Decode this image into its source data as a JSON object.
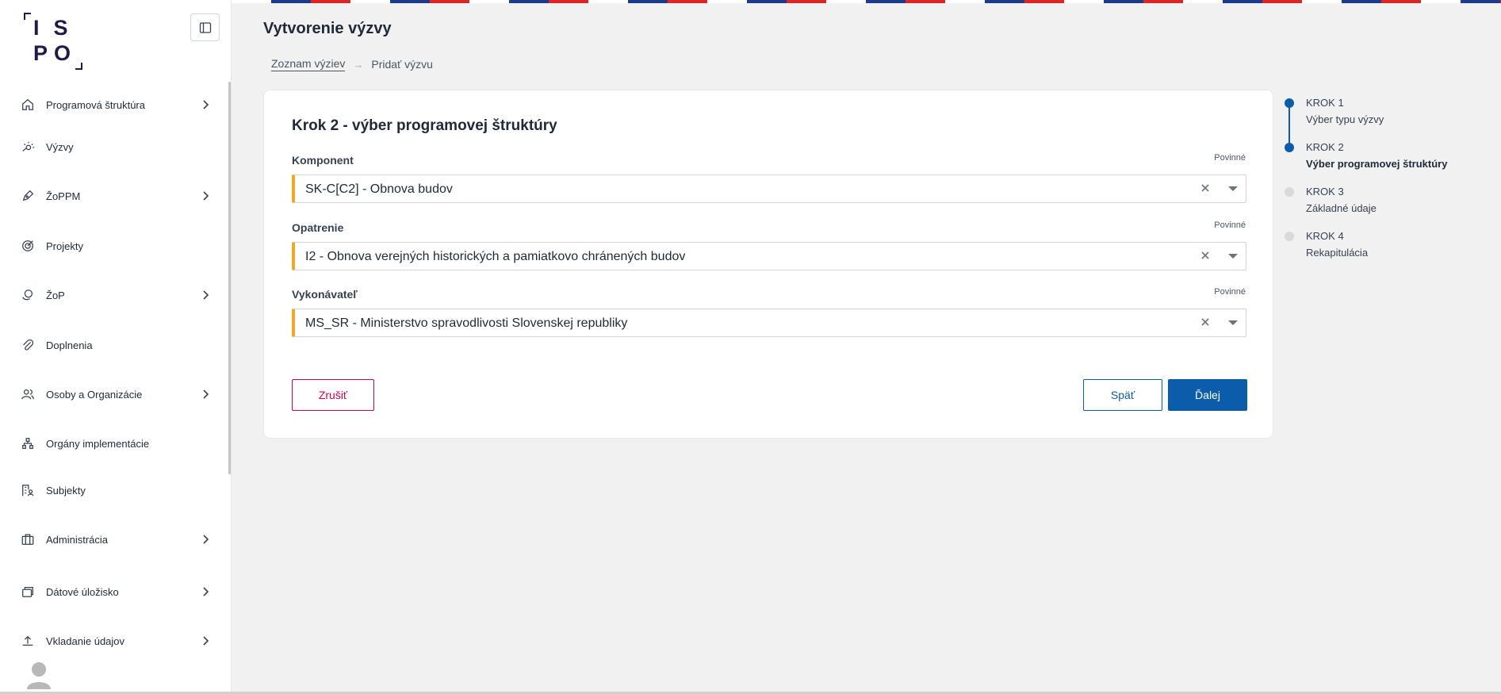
{
  "logo": {
    "line1": "IS",
    "line2": "PO"
  },
  "sidebar": {
    "items": [
      {
        "label": "Programová štruktúra",
        "icon": "home-icon",
        "has_children": true
      },
      {
        "label": "Výzvy",
        "icon": "announcement-icon",
        "has_children": false
      },
      {
        "label": "ŽoPPM",
        "icon": "pen-icon",
        "has_children": true
      },
      {
        "label": "Projekty",
        "icon": "target-icon",
        "has_children": false
      },
      {
        "label": "ŽoP",
        "icon": "coin-icon",
        "has_children": true
      },
      {
        "label": "Doplnenia",
        "icon": "paperclip-icon",
        "has_children": false
      },
      {
        "label": "Osoby a Organizácie",
        "icon": "users-icon",
        "has_children": true
      },
      {
        "label": "Orgány implementácie",
        "icon": "hierarchy-icon",
        "has_children": false
      },
      {
        "label": "Subjekty",
        "icon": "building-user-icon",
        "has_children": false
      },
      {
        "label": "Administrácia",
        "icon": "briefcase-icon",
        "has_children": true
      },
      {
        "label": "Dátové úložisko",
        "icon": "database-icon",
        "has_children": true
      },
      {
        "label": "Vkladanie údajov",
        "icon": "upload-icon",
        "has_children": true
      }
    ]
  },
  "header": {
    "title": "Vytvorenie výzvy",
    "breadcrumb": {
      "link": "Zoznam výziev",
      "separator": "→",
      "current": "Pridať výzvu"
    }
  },
  "form": {
    "title": "Krok 2 - výber programovej štruktúry",
    "fields": [
      {
        "label": "Komponent",
        "required": "Povinné",
        "value": "SK-C[C2] - Obnova budov"
      },
      {
        "label": "Opatrenie",
        "required": "Povinné",
        "value": "I2 - Obnova verejných historických a pamiatkovo chránených budov"
      },
      {
        "label": "Vykonávateľ",
        "required": "Povinné",
        "value": "MS_SR - Ministerstvo spravodlivosti Slovenskej republiky"
      }
    ],
    "cancel_label": "Zrušiť",
    "back_label": "Späť",
    "next_label": "Ďalej"
  },
  "stepper": {
    "steps": [
      {
        "num": "KROK 1",
        "name": "Výber typu výzvy",
        "state": "done"
      },
      {
        "num": "KROK 2",
        "name": "Výber programovej štruktúry",
        "state": "current"
      },
      {
        "num": "KROK 3",
        "name": "Základné údaje",
        "state": "todo"
      },
      {
        "num": "KROK 4",
        "name": "Rekapitulácia",
        "state": "todo"
      }
    ]
  },
  "colors": {
    "primary": "#0b5cab",
    "danger": "#d4004e",
    "required_marker": "#f5a623",
    "flag_blue": "#1e3a8a",
    "flag_red": "#dc2626"
  }
}
